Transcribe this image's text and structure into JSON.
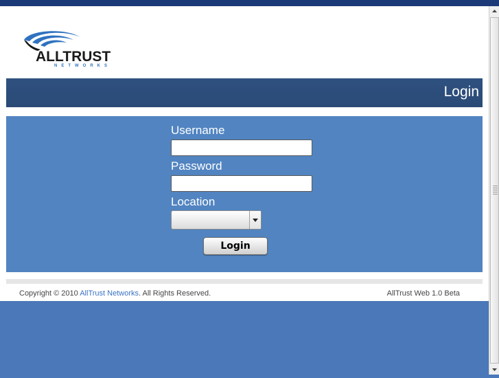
{
  "brand": {
    "name": "ALLTRUST",
    "sub": "NETWORKS"
  },
  "header": {
    "title": "Login"
  },
  "form": {
    "username_label": "Username",
    "username_value": "",
    "password_label": "Password",
    "password_value": "",
    "location_label": "Location",
    "location_value": "",
    "login_button": "Login"
  },
  "footer": {
    "copyright_prefix": "Copyright © 2010 ",
    "company_link": "AllTrust Networks",
    "copyright_suffix": ". All Rights Reserved.",
    "version": "AllTrust Web 1.0 Beta"
  },
  "colors": {
    "header_bar": "#2b4c78",
    "panel": "#5184c1",
    "page_background": "#4a78b8",
    "link": "#3a73c4"
  },
  "icons": {
    "dropdown": "chevron-down-icon"
  }
}
